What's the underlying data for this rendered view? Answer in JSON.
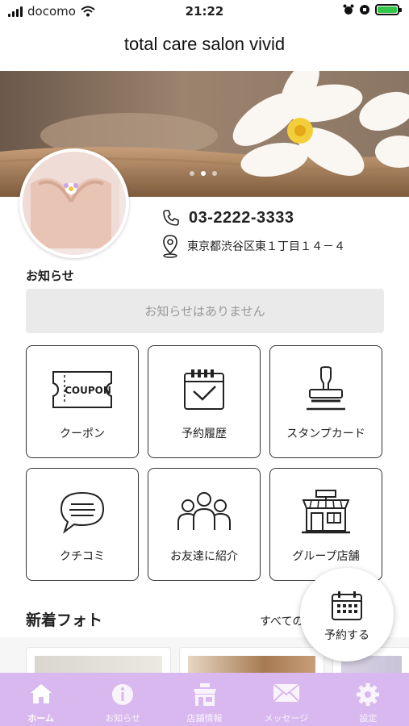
{
  "status_bar": {
    "carrier": "docomo",
    "time": "21:22",
    "battery_color": "#33c64b"
  },
  "header": {
    "title": "total care salon vivid"
  },
  "hero": {
    "carousel_count": 3,
    "active_index": 1
  },
  "contact": {
    "phone": "03-2222-3333",
    "address": "東京都渋谷区東１丁目１４－４"
  },
  "news": {
    "label": "お知らせ",
    "empty_text": "お知らせはありません"
  },
  "menu": {
    "coupon_icon_text": "COUPON",
    "items": [
      {
        "label": "クーポン",
        "icon": "coupon-icon"
      },
      {
        "label": "予約履歴",
        "icon": "calendar-check-icon"
      },
      {
        "label": "スタンプカード",
        "icon": "stamp-icon"
      },
      {
        "label": "クチコミ",
        "icon": "speech-bubble-icon"
      },
      {
        "label": "お友達に紹介",
        "icon": "people-icon"
      },
      {
        "label": "グループ店舗",
        "icon": "store-icon"
      }
    ]
  },
  "photos": {
    "title": "新着フォト",
    "see_all": "すべての"
  },
  "fab": {
    "label": "予約する",
    "icon": "calendar-icon"
  },
  "tab_bar": {
    "background": "#d9b8ef",
    "items": [
      {
        "label": "ホーム",
        "icon": "home-icon",
        "active": true
      },
      {
        "label": "お知らせ",
        "icon": "info-icon",
        "active": false
      },
      {
        "label": "店舗情報",
        "icon": "shop-icon",
        "active": false
      },
      {
        "label": "メッセージ",
        "icon": "mail-icon",
        "active": false
      },
      {
        "label": "設定",
        "icon": "gear-icon",
        "active": false
      }
    ]
  }
}
